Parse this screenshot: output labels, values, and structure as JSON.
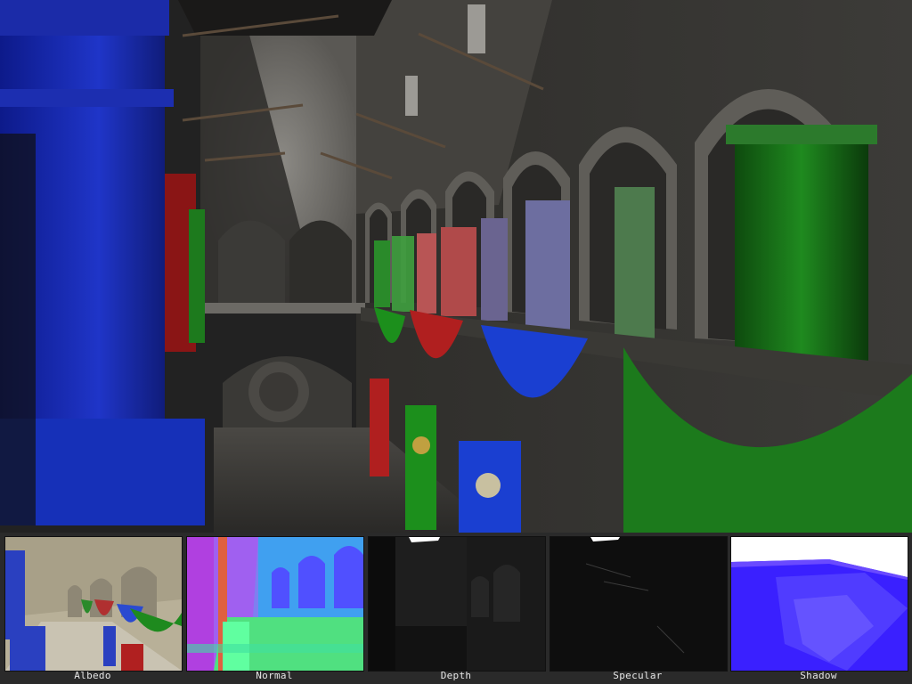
{
  "viewport": {
    "scene": "atrium-render"
  },
  "gbuffer": {
    "panels": [
      {
        "label": "Albedo"
      },
      {
        "label": "Normal"
      },
      {
        "label": "Depth"
      },
      {
        "label": "Specular"
      },
      {
        "label": "Shadow"
      }
    ]
  },
  "colors": {
    "bar_bg": "#2a2a2a",
    "label_text": "#e6e6e6",
    "curtain_blue": "#1a3fd1",
    "curtain_red": "#b01f1f",
    "curtain_green": "#1c8f1c",
    "shadow_blue": "#3a20ff"
  }
}
